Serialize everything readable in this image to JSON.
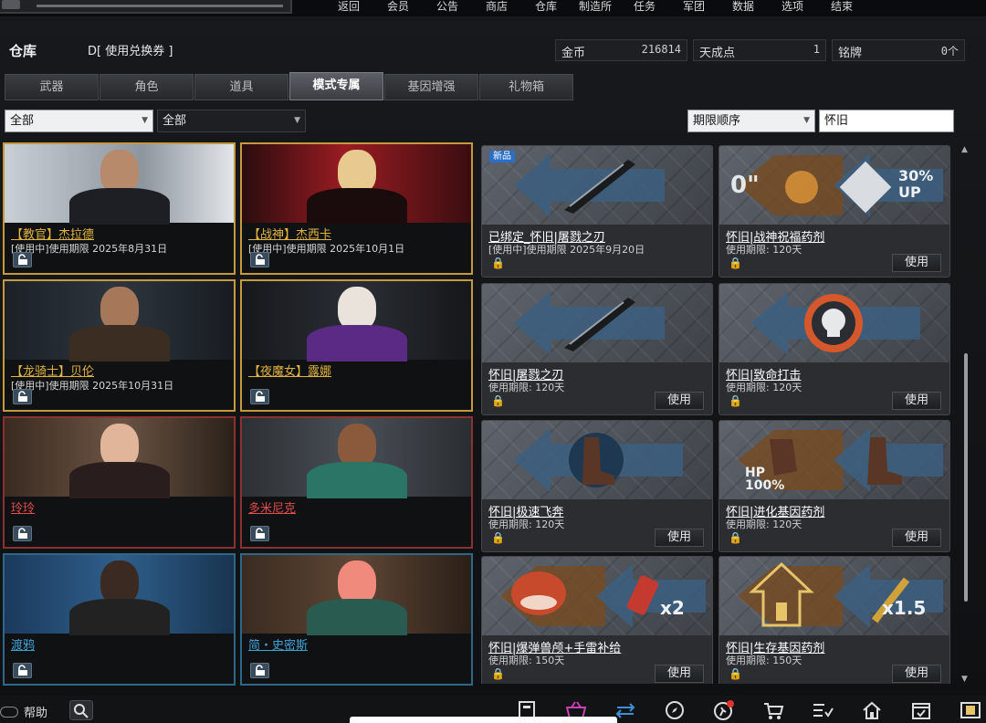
{
  "nav": [
    "返回",
    "会员",
    "公告",
    "商店",
    "仓库",
    "制造所",
    "任务",
    "军团",
    "数据",
    "选项",
    "结束"
  ],
  "header": {
    "title": "仓库",
    "voucher": "D[ 使用兑换券 ]"
  },
  "currency": [
    {
      "label": "金币",
      "value": "216814"
    },
    {
      "label": "天成点",
      "value": "1"
    },
    {
      "label": "铭牌",
      "value": "0个"
    }
  ],
  "tabs": [
    "武器",
    "角色",
    "道具",
    "模式专属",
    "基因增强",
    "礼物箱"
  ],
  "active_tab": "模式专属",
  "filters": {
    "filter1": "全部",
    "filter2": "全部",
    "sort": "期限顺序",
    "search": "怀旧"
  },
  "characters": [
    {
      "name": "【教官】杰拉德",
      "status": "[使用中]使用期限 2025年8月31日",
      "frame": "gold"
    },
    {
      "name": "【战神】杰西卡",
      "status": "[使用中]使用期限 2025年10月1日",
      "frame": "gold"
    },
    {
      "name": "【龙骑士】贝伦",
      "status": "[使用中]使用期限 2025年10月31日",
      "frame": "gold"
    },
    {
      "name": "【夜魔女】露娜",
      "status": "",
      "frame": "gold"
    },
    {
      "name": "玲玲",
      "status": "",
      "frame": "red"
    },
    {
      "name": "多米尼克",
      "status": "",
      "frame": "red"
    },
    {
      "name": "渡鸦",
      "status": "",
      "frame": "blue"
    },
    {
      "name": "简・史密斯",
      "status": "",
      "frame": "blue"
    }
  ],
  "items": [
    {
      "name": "已绑定_怀旧|屠戮之刃",
      "detail": "[使用中]使用期限 2025年9月20日",
      "badge": "新品",
      "use": ""
    },
    {
      "name": "怀旧|战神祝福药剂",
      "detail": "使用期限: 120天",
      "badge": "",
      "use": "使用",
      "art_text": "0\"",
      "art_text2": "30% UP"
    },
    {
      "name": "怀旧|屠戮之刃",
      "detail": "使用期限: 120天",
      "badge": "",
      "use": "使用"
    },
    {
      "name": "怀旧|致命打击",
      "detail": "使用期限: 120天",
      "badge": "",
      "use": "使用"
    },
    {
      "name": "怀旧|极速飞奔",
      "detail": "使用期限: 120天",
      "badge": "",
      "use": "使用"
    },
    {
      "name": "怀旧|进化基因药剂",
      "detail": "使用期限: 120天",
      "badge": "",
      "use": "使用",
      "art_text": "HP 100%"
    },
    {
      "name": "怀旧|爆弹兽颅+手雷补给",
      "detail": "使用期限: 150天",
      "badge": "",
      "use": "使用",
      "art_text": "x2"
    },
    {
      "name": "怀旧|生存基因药剂",
      "detail": "使用期限: 150天",
      "badge": "",
      "use": "使用",
      "art_text": "x1.5"
    }
  ],
  "bottom": {
    "help": "帮助",
    "icons": [
      "inventory-icon",
      "basket-icon",
      "exchange-icon",
      "compass-icon",
      "run-alert-icon",
      "cart-icon",
      "checklist-icon",
      "home-icon",
      "calendar-check-icon",
      "film-icon"
    ]
  },
  "colors": {
    "gold_frame": "#c49a3c",
    "red_frame": "#8b3131",
    "blue_frame": "#2f6788",
    "name_gold": "#e0b342",
    "name_red": "#e24c4c",
    "name_blue": "#3fa3d8"
  }
}
